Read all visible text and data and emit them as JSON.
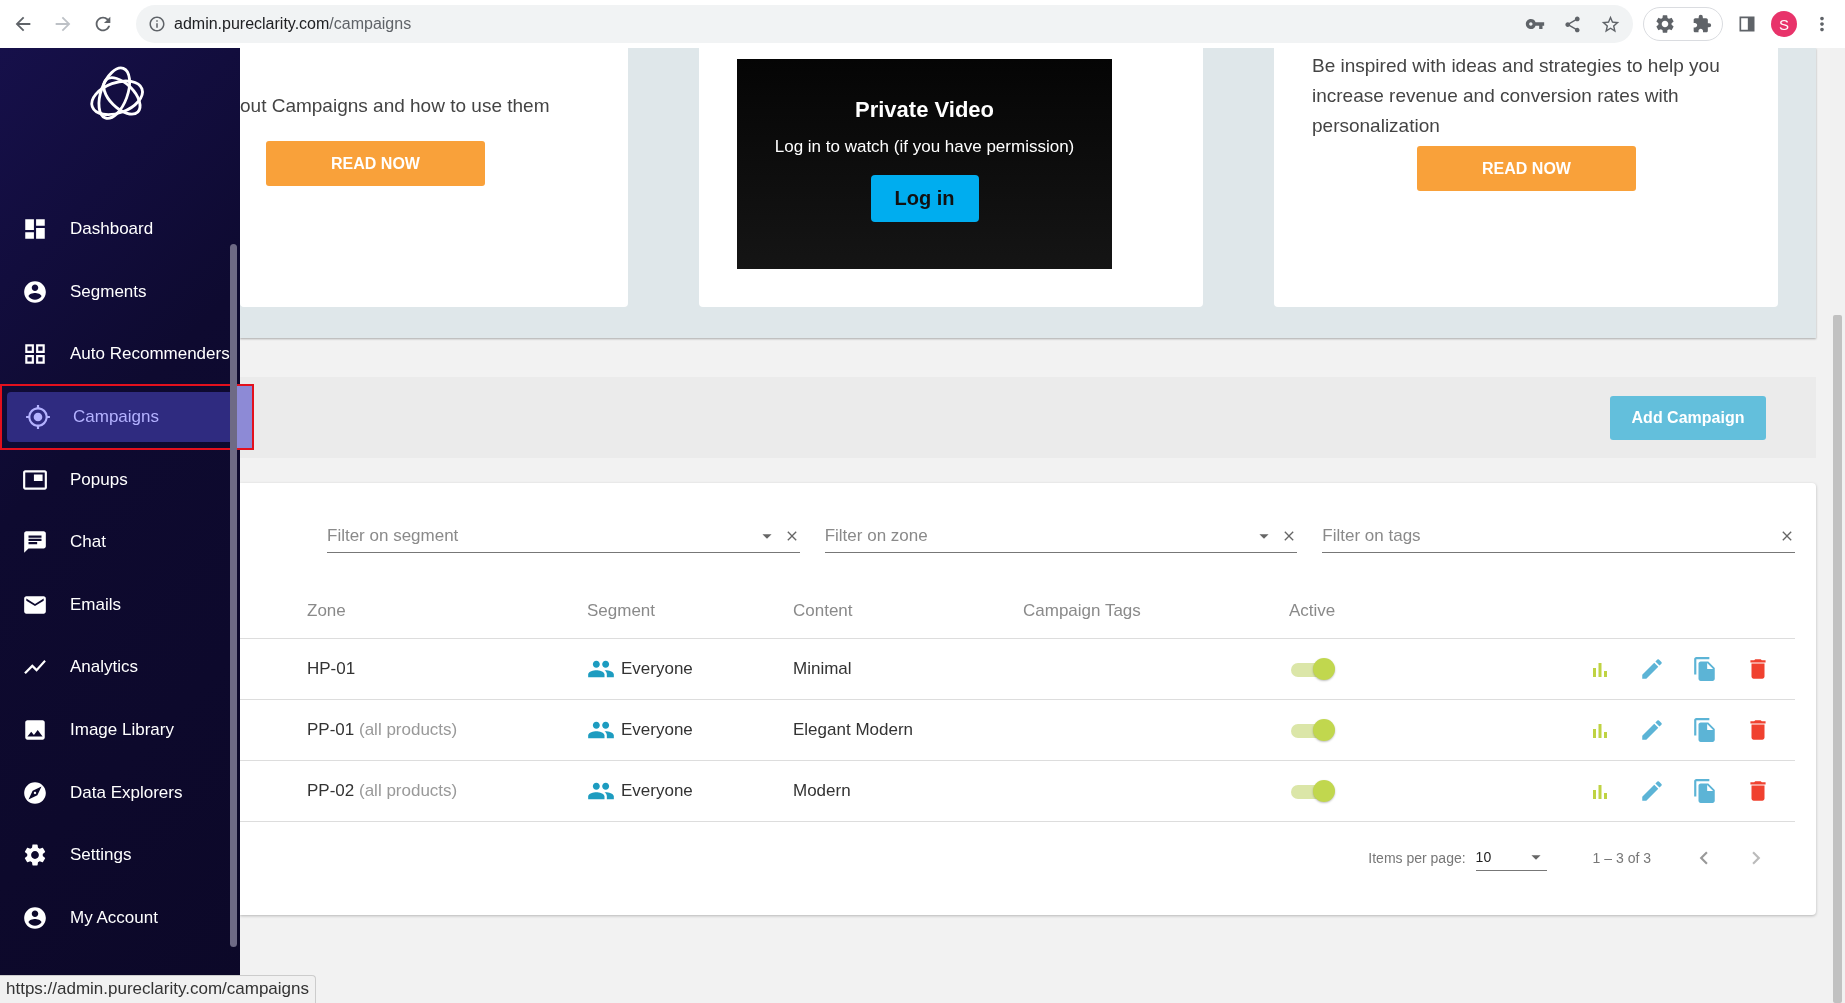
{
  "browser": {
    "url_host": "admin.pureclarity.com",
    "url_path": "/campaigns",
    "profile_initial": "S"
  },
  "sidebar": {
    "items": [
      {
        "label": "Dashboard",
        "selected": false
      },
      {
        "label": "Segments",
        "selected": false
      },
      {
        "label": "Auto Recommenders",
        "selected": false
      },
      {
        "label": "Campaigns",
        "selected": true
      },
      {
        "label": "Popups",
        "selected": false
      },
      {
        "label": "Chat",
        "selected": false
      },
      {
        "label": "Emails",
        "selected": false
      },
      {
        "label": "Analytics",
        "selected": false
      },
      {
        "label": "Image Library",
        "selected": false
      },
      {
        "label": "Data Explorers",
        "selected": false
      },
      {
        "label": "Settings",
        "selected": false
      },
      {
        "label": "My Account",
        "selected": false
      }
    ]
  },
  "cards": [
    {
      "kind": "text",
      "text": "out Campaigns and how to use them",
      "button": "READ NOW"
    },
    {
      "kind": "video",
      "title": "Private Video",
      "text": "Log in to watch (if you have permission)",
      "button": "Log in"
    },
    {
      "kind": "text",
      "text": "Be inspired with ideas and strategies to help you increase revenue and conversion rates with personalization",
      "button": "READ NOW"
    }
  ],
  "toolbar": {
    "button": "Add Campaign"
  },
  "filters": [
    {
      "placeholder": "Filter on segment",
      "dropdown": true
    },
    {
      "placeholder": "Filter on zone",
      "dropdown": true
    },
    {
      "placeholder": "Filter on tags",
      "dropdown": false
    }
  ],
  "table": {
    "columns": [
      "Zone",
      "Segment",
      "Content",
      "Campaign Tags",
      "Active"
    ],
    "rows": [
      {
        "zone": "HP-01",
        "segment": "Everyone",
        "content": "Minimal",
        "active": true
      },
      {
        "zone": "PP-01",
        "zone_note": "(all products)",
        "segment": "Everyone",
        "content": "Elegant Modern",
        "active": true
      },
      {
        "zone": "PP-02",
        "zone_note": "(all products)",
        "segment": "Everyone",
        "content": "Modern",
        "active": true
      }
    ]
  },
  "pagination": {
    "label": "Items per page:",
    "per_page": "10",
    "range": "1 – 3 of 3"
  },
  "status_bar": "https://admin.pureclarity.com/campaigns"
}
